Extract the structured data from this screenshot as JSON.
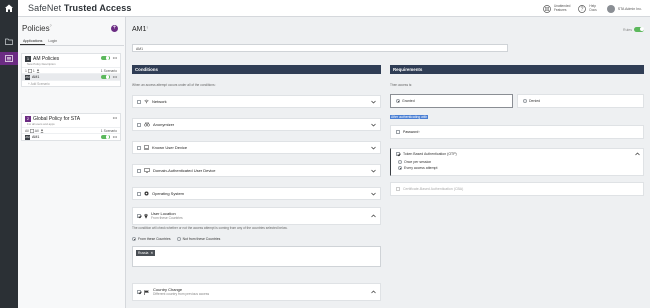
{
  "header": {
    "app_title_prefix": "SafeNet",
    "app_title_suffix": "Trusted Access",
    "actions": [
      {
        "label_line1": "Unattended",
        "label_line2": "Features",
        "icon": "grid-icon"
      },
      {
        "label_line1": "Help",
        "label_line2": "Docs",
        "icon": "help-icon"
      }
    ],
    "user_name": "STA Admin Inc."
  },
  "rail": {
    "items": [
      {
        "icon": "folder-icon"
      },
      {
        "icon": "policies-icon",
        "active": true
      }
    ]
  },
  "policies_panel": {
    "title": "Policies",
    "title_sup": "?",
    "add_icon": "+",
    "tabs": [
      "Applications",
      "Login"
    ],
    "policies": [
      {
        "number": "1",
        "name": "AM Policies",
        "description": "New Policy Description",
        "meta_left_apps": "1",
        "meta_left_rules": "1",
        "meta_right": "1 Scenario",
        "rules": [
          {
            "icon": "AM",
            "name": "AM1",
            "selected": true
          }
        ],
        "add_scenario": "+ Add Scenario"
      },
      {
        "number": "2",
        "name": "Global Policy for STA",
        "description": "For all users and apps",
        "meta_left": "All",
        "meta_left2": "All",
        "meta_right": "1 Scenario",
        "rules": [
          {
            "icon": "AM",
            "name": "AM1",
            "selected": false
          }
        ]
      }
    ]
  },
  "rule": {
    "title": "AM1",
    "title_sup": "?",
    "enabled_label": "Rules",
    "name_value": "AM1"
  },
  "conditions": {
    "title": "Conditions",
    "note": "When an access attempt occurs under all of the conditions:",
    "items": [
      {
        "name": "Network",
        "icon": "network-icon",
        "checked": false
      },
      {
        "name": "Anonymizer",
        "icon": "anonymizer-icon",
        "checked": false
      },
      {
        "name": "Known User Device",
        "icon": "device-icon",
        "checked": false
      },
      {
        "name": "Domain-Authenticated User Device",
        "icon": "monitor-icon",
        "checked": false
      },
      {
        "name": "Operating System",
        "icon": "os-icon",
        "checked": false
      },
      {
        "name": "User Location",
        "sub": "From these Countries",
        "icon": "location-icon",
        "checked": true
      },
      {
        "name": "Country Change",
        "sub": "Different country from previous access",
        "icon": "flag-icon",
        "checked": true
      }
    ],
    "location_note": "The condition will check whether or not the access attempt is coming from any of the countries selected below.",
    "location_options": [
      "From these Countries",
      "Not from these Countries"
    ],
    "selected_country": "Russia"
  },
  "requirements": {
    "title": "Requirements",
    "note": "Then access is:",
    "access_options": [
      {
        "label": "Granted",
        "selected": true
      },
      {
        "label": "Denied",
        "selected": false
      }
    ],
    "after_auth_label": "After authenticating with",
    "password_label": "Password",
    "token_label": "Token Based Authentication (OTP)",
    "token_options": [
      {
        "label": "Once per session",
        "selected": false
      },
      {
        "label": "Every access attempt",
        "selected": true
      }
    ],
    "cba_label": "Certificate-Based Authentication (CBA)"
  },
  "colors": {
    "rail": "#2b3035",
    "accent": "#6b2c83",
    "section_bar": "#2f3d55",
    "toggle_on": "#5cb85c",
    "highlight": "#4a7fd4"
  }
}
